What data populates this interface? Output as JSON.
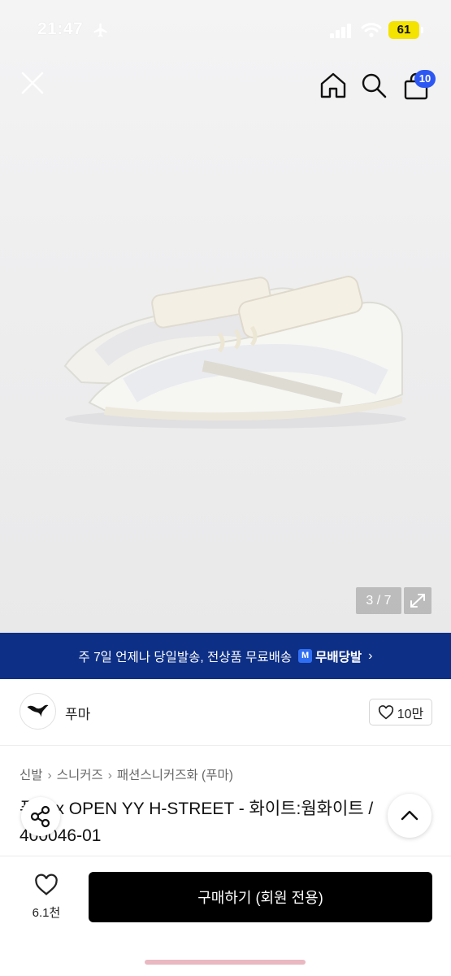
{
  "status_bar": {
    "time": "21:47",
    "battery": "61"
  },
  "header": {
    "cart_count": "10"
  },
  "gallery": {
    "counter": "3 / 7"
  },
  "shipping_banner": {
    "text": "주 7일 언제나 당일발송, 전상품 무료배송",
    "brand": "무배당발",
    "logo_letter": "M",
    "chevron": "›"
  },
  "brand": {
    "name": "푸마",
    "like_count": "10만"
  },
  "breadcrumb": [
    "신발",
    "스니커즈",
    "패션스니커즈화 (푸마)"
  ],
  "breadcrumb_sep": "›",
  "product": {
    "title_line1": "푸마 x OPEN YY H-STREET - 화이트:웜화이트 /",
    "title_line2": "400046-01"
  },
  "bottom_bar": {
    "wish_count": "6.1천",
    "buy_label": "구매하기 (회원 전용)"
  },
  "colors": {
    "banner": "#0d2f86",
    "badge": "#2d57f3",
    "battery": "#f4e200",
    "buy_button": "#000000"
  }
}
